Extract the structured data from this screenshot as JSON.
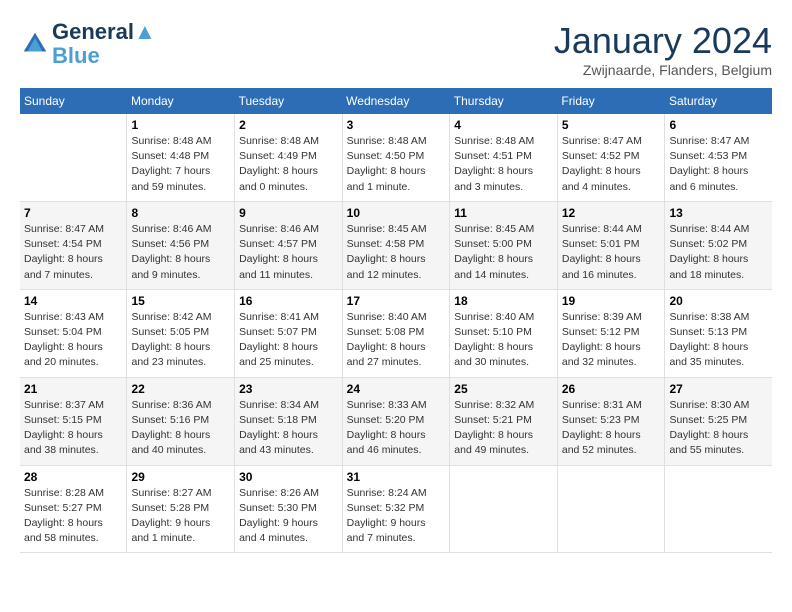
{
  "logo": {
    "line1": "General",
    "line2": "Blue"
  },
  "title": "January 2024",
  "subtitle": "Zwijnaarde, Flanders, Belgium",
  "days_header": [
    "Sunday",
    "Monday",
    "Tuesday",
    "Wednesday",
    "Thursday",
    "Friday",
    "Saturday"
  ],
  "weeks": [
    [
      {
        "num": "",
        "info": ""
      },
      {
        "num": "1",
        "info": "Sunrise: 8:48 AM\nSunset: 4:48 PM\nDaylight: 7 hours\nand 59 minutes."
      },
      {
        "num": "2",
        "info": "Sunrise: 8:48 AM\nSunset: 4:49 PM\nDaylight: 8 hours\nand 0 minutes."
      },
      {
        "num": "3",
        "info": "Sunrise: 8:48 AM\nSunset: 4:50 PM\nDaylight: 8 hours\nand 1 minute."
      },
      {
        "num": "4",
        "info": "Sunrise: 8:48 AM\nSunset: 4:51 PM\nDaylight: 8 hours\nand 3 minutes."
      },
      {
        "num": "5",
        "info": "Sunrise: 8:47 AM\nSunset: 4:52 PM\nDaylight: 8 hours\nand 4 minutes."
      },
      {
        "num": "6",
        "info": "Sunrise: 8:47 AM\nSunset: 4:53 PM\nDaylight: 8 hours\nand 6 minutes."
      }
    ],
    [
      {
        "num": "7",
        "info": "Sunrise: 8:47 AM\nSunset: 4:54 PM\nDaylight: 8 hours\nand 7 minutes."
      },
      {
        "num": "8",
        "info": "Sunrise: 8:46 AM\nSunset: 4:56 PM\nDaylight: 8 hours\nand 9 minutes."
      },
      {
        "num": "9",
        "info": "Sunrise: 8:46 AM\nSunset: 4:57 PM\nDaylight: 8 hours\nand 11 minutes."
      },
      {
        "num": "10",
        "info": "Sunrise: 8:45 AM\nSunset: 4:58 PM\nDaylight: 8 hours\nand 12 minutes."
      },
      {
        "num": "11",
        "info": "Sunrise: 8:45 AM\nSunset: 5:00 PM\nDaylight: 8 hours\nand 14 minutes."
      },
      {
        "num": "12",
        "info": "Sunrise: 8:44 AM\nSunset: 5:01 PM\nDaylight: 8 hours\nand 16 minutes."
      },
      {
        "num": "13",
        "info": "Sunrise: 8:44 AM\nSunset: 5:02 PM\nDaylight: 8 hours\nand 18 minutes."
      }
    ],
    [
      {
        "num": "14",
        "info": "Sunrise: 8:43 AM\nSunset: 5:04 PM\nDaylight: 8 hours\nand 20 minutes."
      },
      {
        "num": "15",
        "info": "Sunrise: 8:42 AM\nSunset: 5:05 PM\nDaylight: 8 hours\nand 23 minutes."
      },
      {
        "num": "16",
        "info": "Sunrise: 8:41 AM\nSunset: 5:07 PM\nDaylight: 8 hours\nand 25 minutes."
      },
      {
        "num": "17",
        "info": "Sunrise: 8:40 AM\nSunset: 5:08 PM\nDaylight: 8 hours\nand 27 minutes."
      },
      {
        "num": "18",
        "info": "Sunrise: 8:40 AM\nSunset: 5:10 PM\nDaylight: 8 hours\nand 30 minutes."
      },
      {
        "num": "19",
        "info": "Sunrise: 8:39 AM\nSunset: 5:12 PM\nDaylight: 8 hours\nand 32 minutes."
      },
      {
        "num": "20",
        "info": "Sunrise: 8:38 AM\nSunset: 5:13 PM\nDaylight: 8 hours\nand 35 minutes."
      }
    ],
    [
      {
        "num": "21",
        "info": "Sunrise: 8:37 AM\nSunset: 5:15 PM\nDaylight: 8 hours\nand 38 minutes."
      },
      {
        "num": "22",
        "info": "Sunrise: 8:36 AM\nSunset: 5:16 PM\nDaylight: 8 hours\nand 40 minutes."
      },
      {
        "num": "23",
        "info": "Sunrise: 8:34 AM\nSunset: 5:18 PM\nDaylight: 8 hours\nand 43 minutes."
      },
      {
        "num": "24",
        "info": "Sunrise: 8:33 AM\nSunset: 5:20 PM\nDaylight: 8 hours\nand 46 minutes."
      },
      {
        "num": "25",
        "info": "Sunrise: 8:32 AM\nSunset: 5:21 PM\nDaylight: 8 hours\nand 49 minutes."
      },
      {
        "num": "26",
        "info": "Sunrise: 8:31 AM\nSunset: 5:23 PM\nDaylight: 8 hours\nand 52 minutes."
      },
      {
        "num": "27",
        "info": "Sunrise: 8:30 AM\nSunset: 5:25 PM\nDaylight: 8 hours\nand 55 minutes."
      }
    ],
    [
      {
        "num": "28",
        "info": "Sunrise: 8:28 AM\nSunset: 5:27 PM\nDaylight: 8 hours\nand 58 minutes."
      },
      {
        "num": "29",
        "info": "Sunrise: 8:27 AM\nSunset: 5:28 PM\nDaylight: 9 hours\nand 1 minute."
      },
      {
        "num": "30",
        "info": "Sunrise: 8:26 AM\nSunset: 5:30 PM\nDaylight: 9 hours\nand 4 minutes."
      },
      {
        "num": "31",
        "info": "Sunrise: 8:24 AM\nSunset: 5:32 PM\nDaylight: 9 hours\nand 7 minutes."
      },
      {
        "num": "",
        "info": ""
      },
      {
        "num": "",
        "info": ""
      },
      {
        "num": "",
        "info": ""
      }
    ]
  ]
}
